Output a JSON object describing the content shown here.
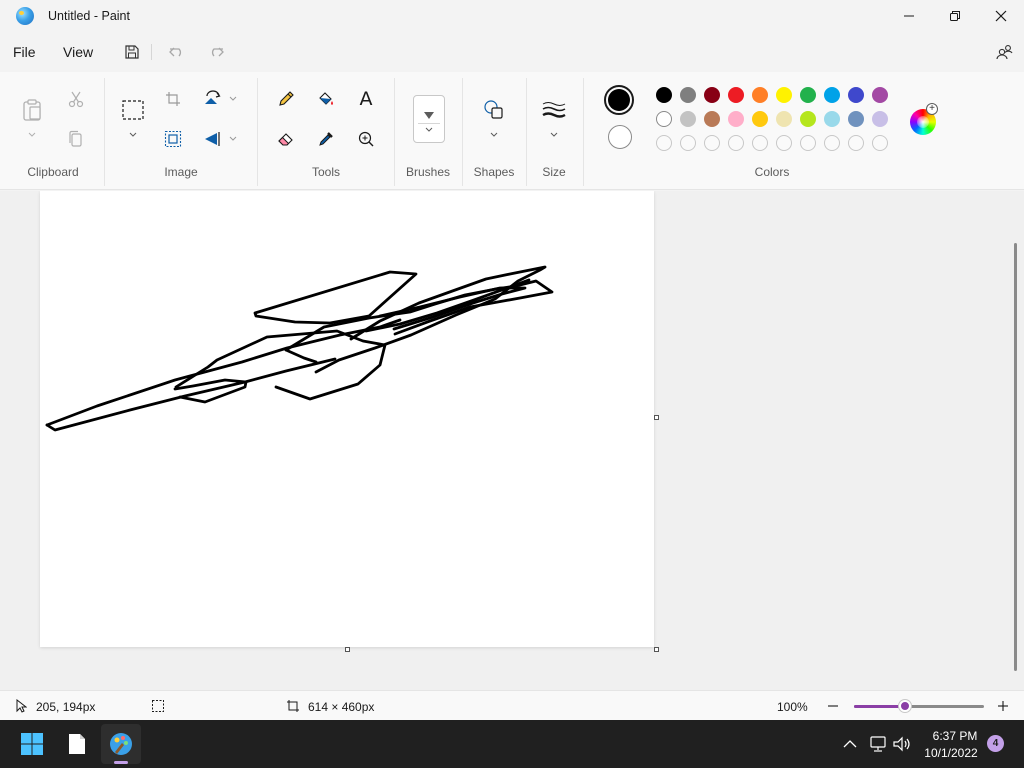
{
  "window": {
    "title": "Untitled - Paint",
    "app_icon": "paint-palette-icon",
    "controls": [
      "minimize-icon",
      "maximize-icon",
      "close-icon"
    ]
  },
  "menu": {
    "file_label": "File",
    "view_label": "View",
    "quick_actions": [
      "save-icon",
      "undo-icon",
      "redo-icon"
    ],
    "share_icon": "profile-share-icon"
  },
  "ribbon": {
    "groups": {
      "clipboard": "Clipboard",
      "image": "Image",
      "tools": "Tools",
      "brushes": "Brushes",
      "shapes": "Shapes",
      "size": "Size",
      "colors": "Colors"
    },
    "clipboard_tools": [
      "paste-icon",
      "cut-icon",
      "copy-icon"
    ],
    "image_tools": [
      "select-rectangle-icon",
      "crop-icon",
      "resize-icon",
      "rotate-icon",
      "flip-icon"
    ],
    "tools": [
      "pencil-icon",
      "fill-bucket-icon",
      "text-icon",
      "eraser-icon",
      "color-picker-icon",
      "magnifier-icon"
    ],
    "text_tool_glyph": "A",
    "active_colors": {
      "primary": "#000000",
      "secondary": "#ffffff"
    },
    "palette_row1": [
      "#000000",
      "#7f7f7f",
      "#880015",
      "#ed1c24",
      "#ff7f27",
      "#fff200",
      "#22b14c",
      "#00a2e8",
      "#3f48cc",
      "#a349a4"
    ],
    "palette_row2": [
      "#ffffff",
      "#c3c3c3",
      "#b97a57",
      "#ffaec9",
      "#ffc90e",
      "#efe4b0",
      "#b5e61d",
      "#99d9ea",
      "#7092be",
      "#c8bfe7"
    ],
    "palette_row3_empty_count": 10,
    "edit_colors_icon": "color-wheel-icon"
  },
  "canvas": {
    "background": "#ffffff",
    "stroke_color": "#000000"
  },
  "status": {
    "cursor_position": "205, 194px",
    "selection_size": "",
    "canvas_size": "614 × 460px",
    "zoom_level": "100%",
    "zoom_fraction": 0.39
  },
  "taskbar": {
    "apps": [
      "windows-start-icon",
      "file-explorer-icon",
      "paint-app-icon"
    ],
    "time": "6:37 PM",
    "date": "10/1/2022",
    "notification_count": "4",
    "tray_icons": [
      "chevron-up-icon",
      "network-icon",
      "volume-icon"
    ]
  }
}
